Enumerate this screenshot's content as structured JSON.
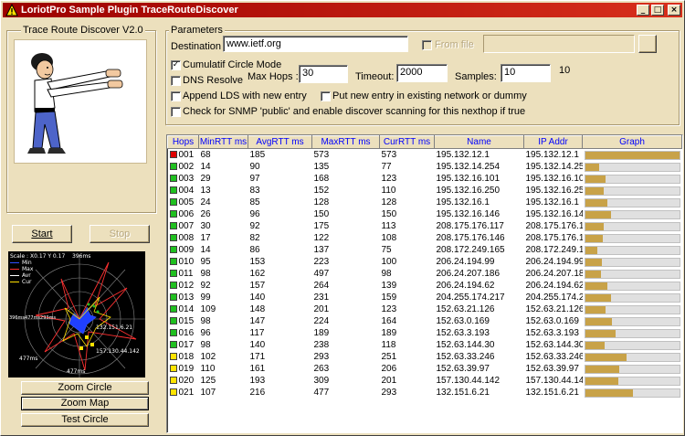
{
  "window": {
    "title": "LoriotPro Sample Plugin TraceRouteDiscover",
    "buttons": {
      "minimize": "_",
      "maximize": "□",
      "close": "×"
    }
  },
  "left_panel": {
    "group_title": "Trace Route Discover V2.0",
    "start_label": "Start",
    "stop_label": "Stop",
    "zoom_circle_label": "Zoom Circle",
    "zoom_map_label": "Zoom Map",
    "test_circle_label": "Test Circle"
  },
  "radar": {
    "legend_title": "Scale : X0.17 Y 0.17",
    "legend": [
      {
        "name": "Min",
        "color": "#3050ff"
      },
      {
        "name": "Max",
        "color": "#ff3030"
      },
      {
        "name": "Avr",
        "color": "#ffffff"
      },
      {
        "name": "Cur",
        "color": "#ffe000"
      }
    ],
    "labels": [
      "396ms",
      "396ms477ms293ms",
      "477ms",
      "477ms",
      "132.151.6.21",
      "157.130.44.142"
    ]
  },
  "parameters": {
    "group_title": "Parameters",
    "destination_label": "Destination :",
    "destination_value": "www.ietf.org",
    "from_file_label": "From file",
    "from_file_value": "",
    "cumulatif_label": "Cumulatif Circle Mode",
    "cumulatif_checked": true,
    "dns_label": "DNS Resolve",
    "dns_checked": false,
    "max_hops_label": "Max Hops :",
    "max_hops_value": "30",
    "timeout_label": "Timeout:",
    "timeout_value": "2000",
    "samples_label": "Samples:",
    "samples_value": "10",
    "samples_readout": "10",
    "append_lds_label": "Append LDS with new entry",
    "put_new_entry_label": "Put new entry in existing network or dummy",
    "snmp_label": "Check for SNMP 'public' and enable discover scanning for this nexthop if true"
  },
  "table": {
    "columns": [
      "Hops",
      "MinRTT ms",
      "AvgRTT ms",
      "MaxRTT ms",
      "CurRTT ms",
      "Name",
      "IP Addr",
      "Graph"
    ],
    "colors": {
      "red": "#e00000",
      "green": "#20c020",
      "yellow": "#ffe400"
    },
    "rows": [
      {
        "hop": "001",
        "status": "red",
        "min": "68",
        "avg": "185",
        "max": "573",
        "cur": "573",
        "name": "195.132.12.1",
        "ip": "195.132.12.1",
        "graph": 1.0
      },
      {
        "hop": "002",
        "status": "green",
        "min": "14",
        "avg": "90",
        "max": "135",
        "cur": "77",
        "name": "195.132.14.254",
        "ip": "195.132.14.25",
        "graph": 0.15
      },
      {
        "hop": "003",
        "status": "green",
        "min": "29",
        "avg": "97",
        "max": "168",
        "cur": "123",
        "name": "195.132.16.101",
        "ip": "195.132.16.10",
        "graph": 0.22
      },
      {
        "hop": "004",
        "status": "green",
        "min": "13",
        "avg": "83",
        "max": "152",
        "cur": "110",
        "name": "195.132.16.250",
        "ip": "195.132.16.25",
        "graph": 0.2
      },
      {
        "hop": "005",
        "status": "green",
        "min": "24",
        "avg": "85",
        "max": "128",
        "cur": "128",
        "name": "195.132.16.1",
        "ip": "195.132.16.1",
        "graph": 0.24
      },
      {
        "hop": "006",
        "status": "green",
        "min": "26",
        "avg": "96",
        "max": "150",
        "cur": "150",
        "name": "195.132.16.146",
        "ip": "195.132.16.14",
        "graph": 0.28
      },
      {
        "hop": "007",
        "status": "green",
        "min": "30",
        "avg": "92",
        "max": "175",
        "cur": "113",
        "name": "208.175.176.117",
        "ip": "208.175.176.1",
        "graph": 0.2
      },
      {
        "hop": "008",
        "status": "green",
        "min": "17",
        "avg": "82",
        "max": "122",
        "cur": "108",
        "name": "208.175.176.146",
        "ip": "208.175.176.1",
        "graph": 0.19
      },
      {
        "hop": "009",
        "status": "green",
        "min": "14",
        "avg": "86",
        "max": "137",
        "cur": "75",
        "name": "208.172.249.165",
        "ip": "208.172.249.1",
        "graph": 0.13
      },
      {
        "hop": "010",
        "status": "green",
        "min": "95",
        "avg": "153",
        "max": "223",
        "cur": "100",
        "name": "206.24.194.99",
        "ip": "206.24.194.99",
        "graph": 0.18
      },
      {
        "hop": "011",
        "status": "green",
        "min": "98",
        "avg": "162",
        "max": "497",
        "cur": "98",
        "name": "206.24.207.186",
        "ip": "206.24.207.18",
        "graph": 0.17
      },
      {
        "hop": "012",
        "status": "green",
        "min": "92",
        "avg": "157",
        "max": "264",
        "cur": "139",
        "name": "206.24.194.62",
        "ip": "206.24.194.62",
        "graph": 0.24
      },
      {
        "hop": "013",
        "status": "green",
        "min": "99",
        "avg": "140",
        "max": "231",
        "cur": "159",
        "name": "204.255.174.217",
        "ip": "204.255.174.2",
        "graph": 0.28
      },
      {
        "hop": "014",
        "status": "green",
        "min": "109",
        "avg": "148",
        "max": "201",
        "cur": "123",
        "name": "152.63.21.126",
        "ip": "152.63.21.126",
        "graph": 0.22
      },
      {
        "hop": "015",
        "status": "green",
        "min": "98",
        "avg": "147",
        "max": "224",
        "cur": "164",
        "name": "152.63.0.169",
        "ip": "152.63.0.169",
        "graph": 0.29
      },
      {
        "hop": "016",
        "status": "green",
        "min": "96",
        "avg": "117",
        "max": "189",
        "cur": "189",
        "name": "152.63.3.193",
        "ip": "152.63.3.193",
        "graph": 0.33
      },
      {
        "hop": "017",
        "status": "green",
        "min": "98",
        "avg": "140",
        "max": "238",
        "cur": "118",
        "name": "152.63.144.30",
        "ip": "152.63.144.30",
        "graph": 0.21
      },
      {
        "hop": "018",
        "status": "yellow",
        "min": "102",
        "avg": "171",
        "max": "293",
        "cur": "251",
        "name": "152.63.33.246",
        "ip": "152.63.33.246",
        "graph": 0.44
      },
      {
        "hop": "019",
        "status": "yellow",
        "min": "110",
        "avg": "161",
        "max": "263",
        "cur": "206",
        "name": "152.63.39.97",
        "ip": "152.63.39.97",
        "graph": 0.36
      },
      {
        "hop": "020",
        "status": "yellow",
        "min": "125",
        "avg": "193",
        "max": "309",
        "cur": "201",
        "name": "157.130.44.142",
        "ip": "157.130.44.14",
        "graph": 0.35
      },
      {
        "hop": "021",
        "status": "yellow",
        "min": "107",
        "avg": "216",
        "max": "477",
        "cur": "293",
        "name": "132.151.6.21",
        "ip": "132.151.6.21",
        "graph": 0.51
      }
    ]
  }
}
